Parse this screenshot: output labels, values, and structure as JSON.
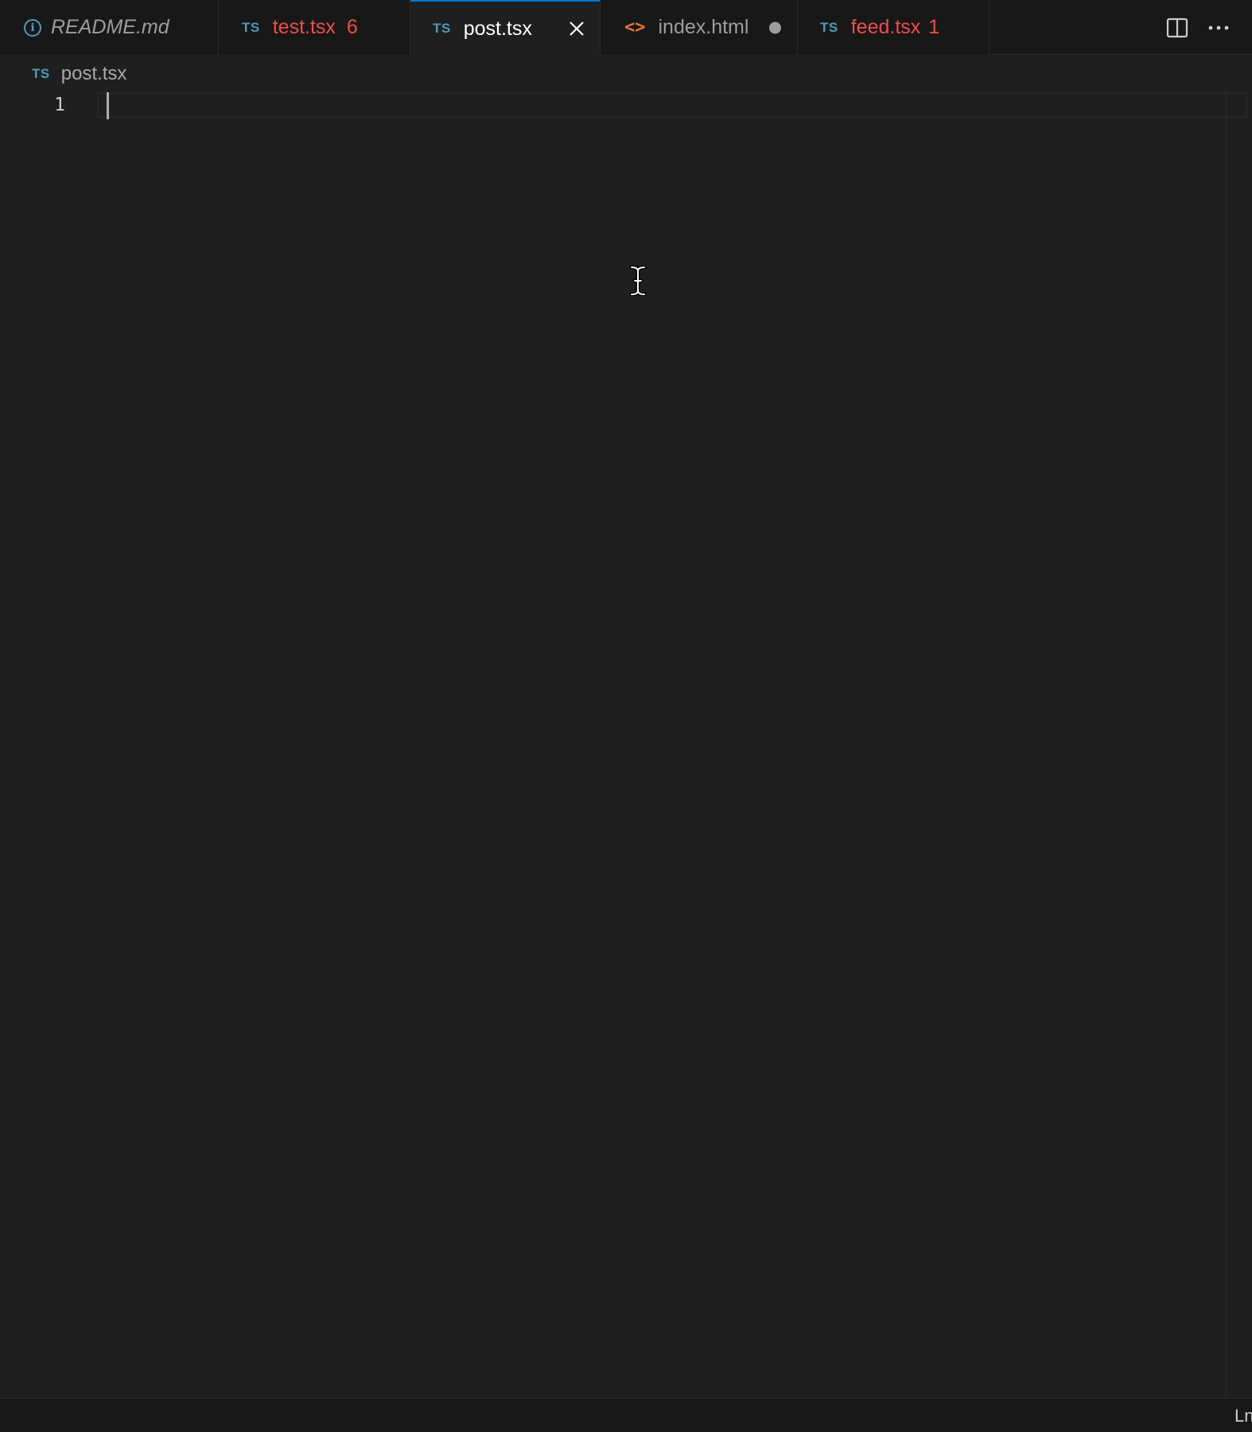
{
  "tabs": [
    {
      "label": "README.md",
      "icon": "info-icon",
      "style": "italic"
    },
    {
      "label": "test.tsx",
      "icon": "typescript-icon",
      "icon_text": "TS",
      "problems": "6",
      "state": "error"
    },
    {
      "label": "post.tsx",
      "icon": "typescript-icon",
      "icon_text": "TS",
      "state": "active"
    },
    {
      "label": "index.html",
      "icon": "html-icon",
      "icon_text": "<>",
      "state": "modified"
    },
    {
      "label": "feed.tsx",
      "icon": "typescript-icon",
      "icon_text": "TS",
      "problems": "1",
      "state": "error"
    }
  ],
  "actions": {
    "split_icon": "split-editor-icon",
    "more_icon": "more-actions-icon"
  },
  "breadcrumb": {
    "icon_text": "TS",
    "file": "post.tsx"
  },
  "editor": {
    "lines": [
      {
        "number": "1",
        "text": ""
      }
    ]
  },
  "statusbar": {
    "position": "Ln"
  },
  "colors": {
    "accent": "#0078d4",
    "error": "#f14c4c",
    "typescript": "#519aba",
    "html": "#e37933"
  }
}
